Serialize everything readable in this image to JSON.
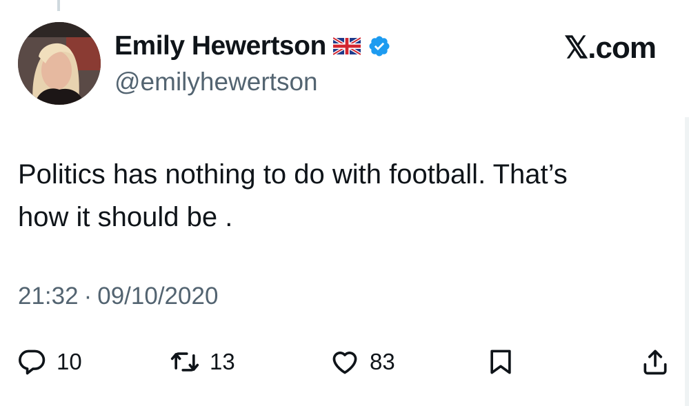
{
  "tweet": {
    "author": {
      "name": "Emily Hewertson",
      "handle": "@emilyhewertson",
      "flag_icon": "uk-flag-icon",
      "verified_icon": "verified-badge-icon"
    },
    "brand": "𝕏.com",
    "text": "Politics has nothing to do with football. That’s\nhow it should be .",
    "time": "21:32",
    "separator": "·",
    "date": "09/10/2020",
    "stats": {
      "replies": "10",
      "reposts": "13",
      "likes": "83"
    },
    "icons": {
      "reply": "reply-icon",
      "repost": "repost-icon",
      "like": "heart-icon",
      "bookmark": "bookmark-icon",
      "share": "share-icon"
    },
    "colors": {
      "text": "#0f1419",
      "secondary": "#536471",
      "verified": "#1d9bf0"
    }
  }
}
